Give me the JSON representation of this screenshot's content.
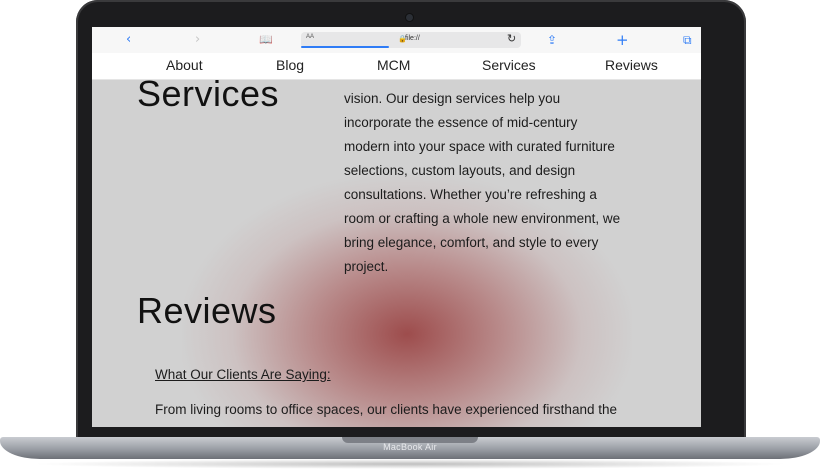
{
  "device": {
    "model_label": "MacBook Air"
  },
  "browser": {
    "back_icon": "‹",
    "forward_icon": "›",
    "bookmarks_icon": "📖",
    "reader_label": "AA",
    "lock_icon": "🔒",
    "url": "file://",
    "reload_icon": "↻",
    "share_icon": "⇪",
    "new_tab_icon": "+",
    "tabs_icon": "⧉",
    "accent_color": "#2f7cf6"
  },
  "nav": {
    "items": [
      "About",
      "Blog",
      "MCM",
      "Services",
      "Reviews"
    ]
  },
  "services": {
    "title": "Services",
    "text": "vision. Our design services help you incorporate the essence of mid-century modern into your space with curated furniture selections, custom layouts, and design consultations. Whether you’re refreshing a room or crafting a whole new environment, we bring elegance, comfort, and style to every project."
  },
  "reviews": {
    "title": "Reviews",
    "subheading": "What Our Clients Are Saying:",
    "text": "From living rooms to office spaces, our clients have experienced firsthand the"
  },
  "colors": {
    "page_background": "#d1d1d1",
    "glow": "#963a3a",
    "laptop_frame": "#1c1c1e"
  }
}
